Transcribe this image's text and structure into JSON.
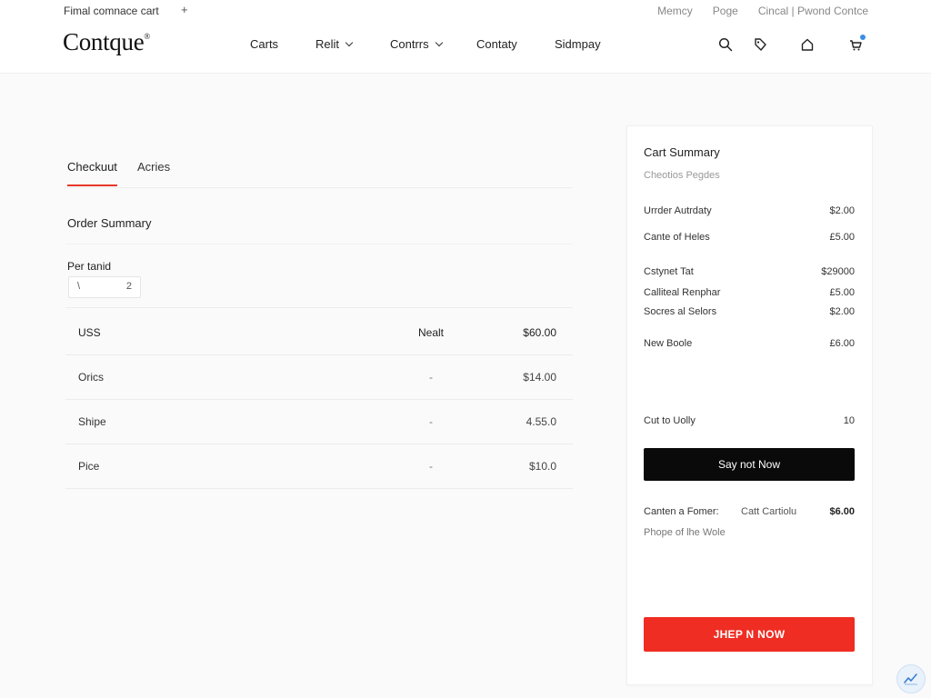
{
  "browser": {
    "tab_title": "Fimal comnace cart",
    "new_tab": "+"
  },
  "utility_links": [
    "Memcy",
    "Poge",
    "Cincal | Pwond Contce"
  ],
  "brand": {
    "logo": "Contque",
    "mark": "®"
  },
  "nav": [
    {
      "label": "Carts",
      "dropdown": false
    },
    {
      "label": "Relit",
      "dropdown": true
    },
    {
      "label": "Contrrs",
      "dropdown": true
    },
    {
      "label": "Contaty",
      "dropdown": false
    },
    {
      "label": "Sidmpay",
      "dropdown": false
    }
  ],
  "header_icons": [
    "search-icon",
    "tag-icon",
    "home-icon",
    "cart-icon"
  ],
  "tabs": [
    {
      "label": "Checkuut",
      "active": true
    },
    {
      "label": "Acries",
      "active": false
    }
  ],
  "order": {
    "title": "Order Summary",
    "period_label": "Per tanid",
    "period_value_left": "\\",
    "period_value_right": "2",
    "header": {
      "c1": "USS",
      "c2": "Nealt",
      "c3": "$60.00"
    },
    "rows": [
      {
        "c1": "Orics",
        "c2": "-",
        "c3": "$14.00"
      },
      {
        "c1": "Shipe",
        "c2": "-",
        "c3": "4.55.0"
      },
      {
        "c1": "Pice",
        "c2": "-",
        "c3": "$10.0"
      }
    ]
  },
  "cart_summary": {
    "title": "Cart Summary",
    "subtitle": "Cheotios Pegdes",
    "lines": [
      {
        "label": "Urrder Autrdaty",
        "amount": "$2.00"
      },
      {
        "label": "Cante of Heles",
        "amount": "£5.00"
      },
      {
        "label": "Cstynet Tat",
        "amount": "$29000"
      },
      {
        "label": "Calliteal Renphar",
        "amount": "£5.00"
      },
      {
        "label": "Socres al Selors",
        "amount": "$2.00"
      },
      {
        "label": "New Boole",
        "amount": "£6.00"
      },
      {
        "label": "Cut to Uolly",
        "amount": "10"
      }
    ],
    "primary_button": "Say not Now",
    "note_left": "Canten a Fomer:",
    "note_mid": "Catt Cartiolu",
    "note_amount": "$6.00",
    "note_sub": "Phope of lhe Wole",
    "cta_button": "JHEP N NOW"
  },
  "colors": {
    "accent_red": "#ef2d22",
    "tab_underline": "#e8372a",
    "dark_button": "#0a0a0a",
    "badge_blue": "#3a8ee6"
  }
}
